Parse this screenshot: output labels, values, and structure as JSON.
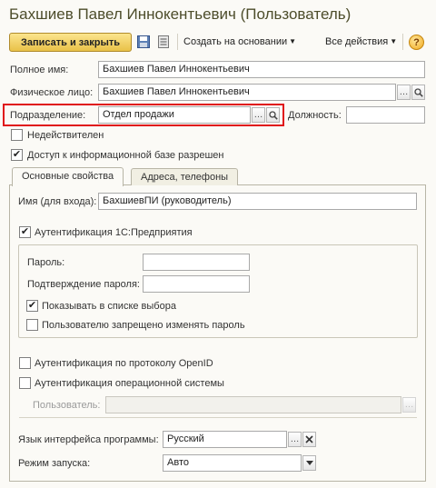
{
  "window": {
    "title": "Бахшиев Павел Иннокентьевич (Пользователь)"
  },
  "toolbar": {
    "save_close_label": "Записать и закрыть",
    "create_basis_label": "Создать на основании",
    "all_actions_label": "Все действия",
    "help_label": "?"
  },
  "form": {
    "full_name_label": "Полное имя:",
    "full_name_value": "Бахшиев Павел Иннокентьевич",
    "person_label": "Физическое лицо:",
    "person_value": "Бахшиев Павел Иннокентьевич",
    "department_label": "Подразделение:",
    "department_value": "Отдел продажи",
    "position_label": "Должность:",
    "position_value": "",
    "inactive_label": "Недействителен",
    "inactive_checked": false,
    "ib_access_label": "Доступ к информационной базе разрешен",
    "ib_access_checked": true
  },
  "tabs": [
    {
      "label": "Основные свойства",
      "active": true
    },
    {
      "label": "Адреса, телефоны",
      "active": false
    }
  ],
  "main": {
    "login_label": "Имя (для входа):",
    "login_value": "БахшиевПИ (руководитель)",
    "auth_1c_label": "Аутентификация 1С:Предприятия",
    "auth_1c_checked": true,
    "password_label": "Пароль:",
    "password_value": "",
    "password_confirm_label": "Подтверждение пароля:",
    "password_confirm_value": "",
    "show_in_list_label": "Показывать в списке выбора",
    "show_in_list_checked": true,
    "forbid_change_pw_label": "Пользователю запрещено изменять пароль",
    "forbid_change_pw_checked": false,
    "openid_label": "Аутентификация по протоколу OpenID",
    "openid_checked": false,
    "os_auth_label": "Аутентификация операционной системы",
    "os_auth_checked": false,
    "os_user_label": "Пользователь:",
    "os_user_value": "",
    "ui_lang_label": "Язык интерфейса программы:",
    "ui_lang_value": "Русский",
    "launch_mode_label": "Режим запуска:",
    "launch_mode_value": "Авто"
  },
  "colors": {
    "title": "#4d4d2b",
    "primary_button": "#e9c148",
    "highlight_border": "#e0141a"
  }
}
